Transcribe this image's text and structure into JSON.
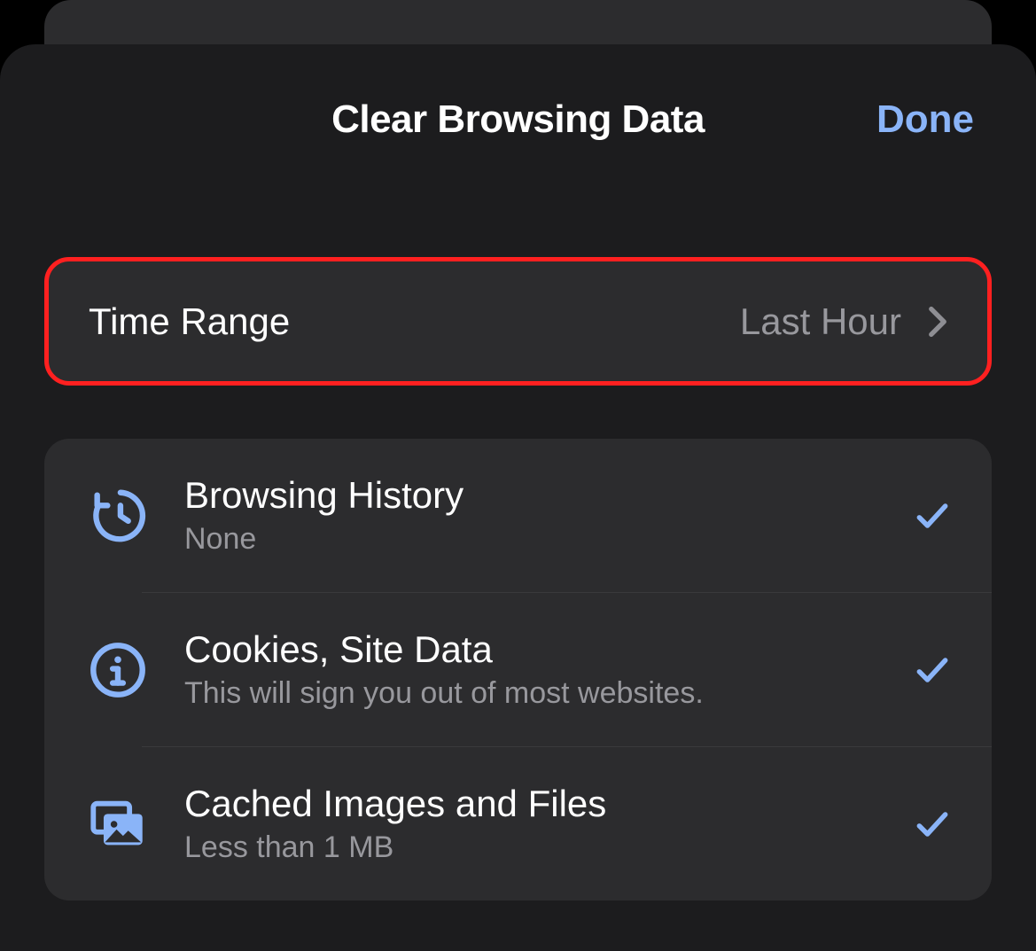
{
  "header": {
    "title": "Clear Browsing Data",
    "done": "Done"
  },
  "timeRange": {
    "label": "Time Range",
    "value": "Last Hour"
  },
  "items": [
    {
      "title": "Browsing History",
      "sub": "None",
      "icon": "history-icon",
      "checked": true
    },
    {
      "title": "Cookies, Site Data",
      "sub": "This will sign you out of most websites.",
      "icon": "info-icon",
      "checked": true
    },
    {
      "title": "Cached Images and Files",
      "sub": "Less than 1 MB",
      "icon": "images-icon",
      "checked": true
    }
  ]
}
